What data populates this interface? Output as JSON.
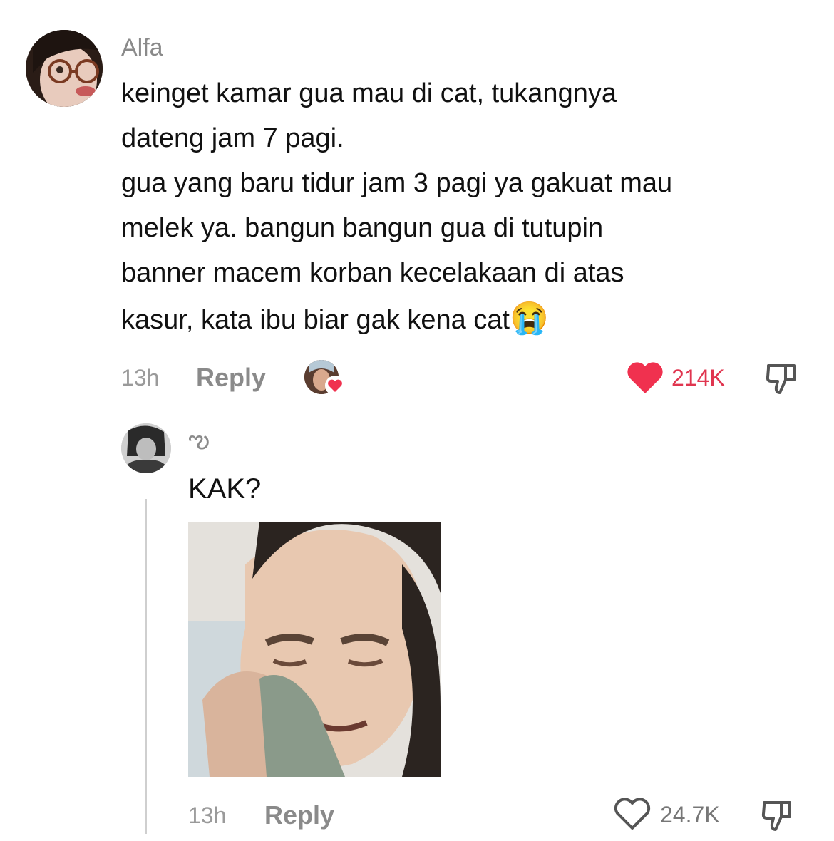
{
  "comment": {
    "username": "Alfa",
    "text": "keinget kamar gua mau di cat, tukangnya\ndateng jam 7 pagi.\ngua yang baru tidur jam 3 pagi ya gakuat mau\nmelek ya. bangun bangun gua di tutupin\nbanner macem korban kecelakaan di atas\nkasur, kata ibu biar gak kena cat",
    "emoji": "😭",
    "time": "13h",
    "reply_label": "Reply",
    "likes": "214K",
    "liked": true,
    "accent_color": "#f0314f"
  },
  "reply": {
    "username": "ఌ",
    "text": "KAK?",
    "time": "13h",
    "reply_label": "Reply",
    "likes": "24.7K",
    "liked": false
  }
}
